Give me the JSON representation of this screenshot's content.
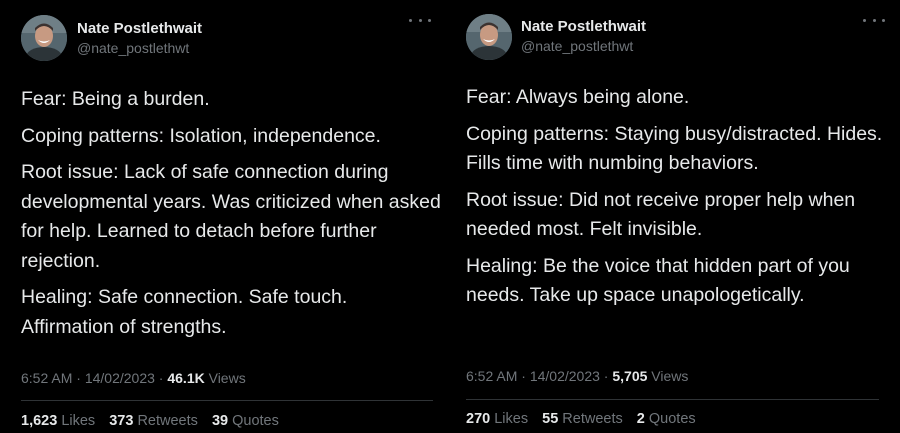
{
  "tweets": [
    {
      "author": {
        "name": "Nate Postlethwait",
        "handle": "@nate_postlethwt"
      },
      "paragraphs": [
        "Fear: Being a burden.",
        "Coping patterns: Isolation, independence.",
        "Root issue: Lack of safe connection during developmental years. Was criticized when asked for help. Learned to detach before further rejection.",
        "Healing: Safe connection. Safe touch. Affirmation of strengths."
      ],
      "time": "6:52 AM",
      "date": "14/02/2023",
      "views_count": "46.1K",
      "views_label": "Views",
      "likes_count": "1,623",
      "likes_label": "Likes",
      "retweets_count": "373",
      "retweets_label": "Retweets",
      "quotes_count": "39",
      "quotes_label": "Quotes"
    },
    {
      "author": {
        "name": "Nate Postlethwait",
        "handle": "@nate_postlethwt"
      },
      "paragraphs": [
        "Fear: Always being alone.",
        "Coping patterns: Staying busy/distracted. Hides. Fills time with numbing behaviors.",
        "Root issue: Did not receive proper help when needed most. Felt invisible.",
        "Healing: Be the voice that hidden part of you needs. Take up space unapologetically."
      ],
      "time": "6:52 AM",
      "date": "14/02/2023",
      "views_count": "5,705",
      "views_label": "Views",
      "likes_count": "270",
      "likes_label": "Likes",
      "retweets_count": "55",
      "retweets_label": "Retweets",
      "quotes_count": "2",
      "quotes_label": "Quotes"
    }
  ],
  "colors": {
    "background": "#000000",
    "primary_text": "#e7e9ea",
    "secondary_text": "#71767b",
    "divider": "#2f3336"
  },
  "icons": {
    "more": "more-horizontal-icon",
    "avatar": "profile-photo"
  }
}
